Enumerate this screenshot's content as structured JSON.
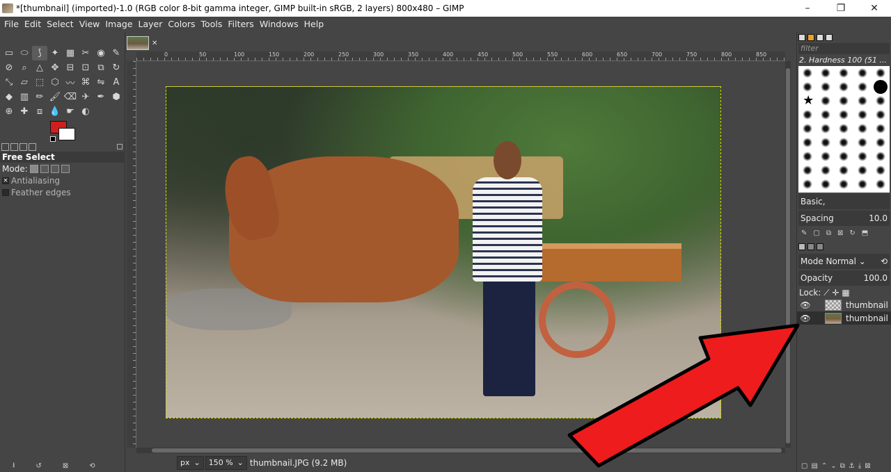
{
  "window": {
    "title": "*[thumbnail] (imported)-1.0 (RGB color 8-bit gamma integer, GIMP built-in sRGB, 2 layers) 800x480 – GIMP",
    "minimize": "–",
    "restore": "❐",
    "close": "✕"
  },
  "menu": [
    "File",
    "Edit",
    "Select",
    "View",
    "Image",
    "Layer",
    "Colors",
    "Tools",
    "Filters",
    "Windows",
    "Help"
  ],
  "toolbox": {
    "tools": [
      "rect-select",
      "ellipse-select",
      "free-select",
      "fuzzy-select",
      "by-color-select",
      "scissors",
      "foreground-select",
      "paths",
      "color-picker",
      "zoom",
      "measure",
      "move",
      "align",
      "crop",
      "unified-transform",
      "rotate",
      "scale",
      "shear",
      "perspective",
      "3d-transform",
      "warp",
      "handle-transform",
      "flip",
      "text",
      "bucket-fill",
      "gradient",
      "pencil",
      "paintbrush",
      "eraser",
      "airbrush",
      "ink",
      "mypaint",
      "clone",
      "heal",
      "perspective-clone",
      "blur",
      "smudge",
      "dodge-burn"
    ],
    "glyphs": [
      "▭",
      "⬭",
      "⟆",
      "✦",
      "▦",
      "✂",
      "◉",
      "✎",
      "⊘",
      "⌕",
      "△",
      "✥",
      "⊟",
      "⊡",
      "⧉",
      "↻",
      "⤡",
      "▱",
      "⬚",
      "⬡",
      "〰",
      "⌘",
      "⇋",
      "A",
      "◆",
      "▥",
      "✏",
      "🖌",
      "⌫",
      "✈",
      "✒",
      "⬢",
      "⊕",
      "✚",
      "⧈",
      "💧",
      "☛",
      "◐"
    ],
    "active_index": 2
  },
  "tool_options": {
    "title": "Free Select",
    "mode_label": "Mode:",
    "antialiasing": "Antialiasing",
    "feather_edges": "Feather edges",
    "antialiasing_checked": true,
    "feather_checked": false
  },
  "canvas": {
    "tab_close": "✕",
    "ruler_labels": [
      "0",
      "50",
      "100",
      "150",
      "200",
      "250",
      "300",
      "350",
      "400",
      "450",
      "500",
      "550",
      "600",
      "650",
      "700",
      "750",
      "800",
      "850"
    ]
  },
  "status": {
    "unit": "px",
    "zoom": "150 %",
    "file_info": "thumbnail.JPG (9.2 MB)"
  },
  "brushes": {
    "filter_placeholder": "filter",
    "selected_brush": "2. Hardness 100 (51 ...",
    "preset": "Basic,",
    "spacing_label": "Spacing",
    "spacing_value": "10.0"
  },
  "layers": {
    "mode_label": "Mode",
    "mode_value": "Normal",
    "opacity_label": "Opacity",
    "opacity_value": "100.0",
    "lock_label": "Lock:",
    "items": [
      {
        "name": "thumbnail",
        "visible": true,
        "thumb": "checker"
      },
      {
        "name": "thumbnail",
        "visible": true,
        "thumb": "photo"
      }
    ]
  },
  "colors": {
    "foreground": "#d11f1f",
    "background": "#ffffff",
    "arrow": "#ee1c1c",
    "ui_bg": "#454545"
  }
}
